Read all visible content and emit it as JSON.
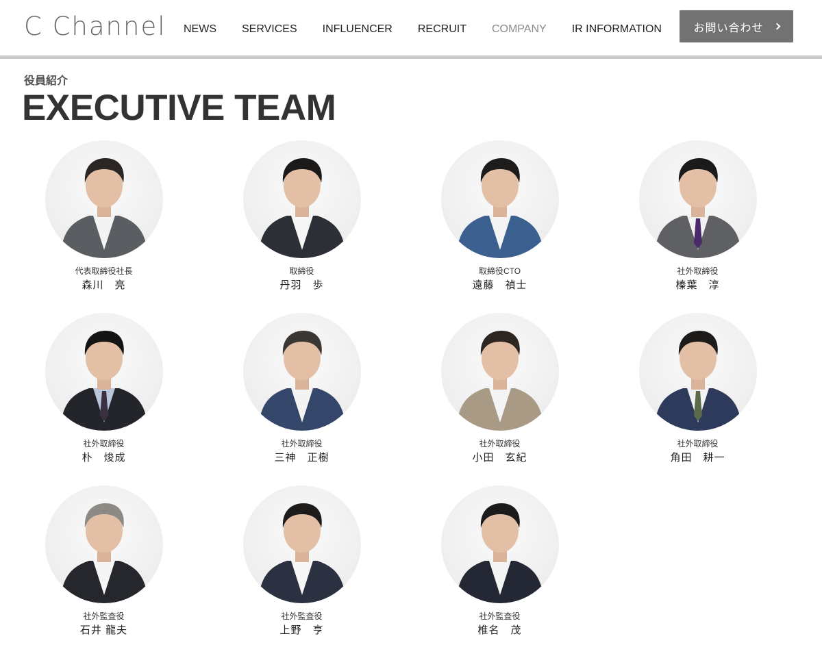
{
  "header": {
    "logo_text": "C Channel",
    "nav": [
      {
        "label": "NEWS",
        "current": false
      },
      {
        "label": "SERVICES",
        "current": false
      },
      {
        "label": "INFLUENCER",
        "current": false
      },
      {
        "label": "RECRUIT",
        "current": false
      },
      {
        "label": "COMPANY",
        "current": true
      },
      {
        "label": "IR INFORMATION",
        "current": false
      }
    ],
    "contact_label": "お問い合わせ",
    "contact_icon": "chevron-right-icon"
  },
  "section": {
    "subtitle": "役員紹介",
    "title": "EXECUTIVE TEAM"
  },
  "members": [
    {
      "role": "代表取締役社長",
      "name": "森川　亮",
      "suit": "#5a5d61",
      "shirt": "#f3f3f3",
      "tie": "",
      "hair": "#2b2623"
    },
    {
      "role": "取締役",
      "name": "丹羽　歩",
      "suit": "#2c2f36",
      "shirt": "#f6f6f6",
      "tie": "",
      "hair": "#1c1a19"
    },
    {
      "role": "取締役CTO",
      "name": "遠藤　禎士",
      "suit": "#3b5f8f",
      "shirt": "#f4f4f4",
      "tie": "",
      "hair": "#1e1c1b"
    },
    {
      "role": "社外取締役",
      "name": "榛葉　淳",
      "suit": "#5e6064",
      "shirt": "#f2f2f2",
      "tie": "#4a2a6a",
      "hair": "#1b1a1a"
    },
    {
      "role": "社外取締役",
      "name": "朴　焌成",
      "suit": "#23252b",
      "shirt": "#b8c6dc",
      "tie": "#3a3040",
      "hair": "#141414"
    },
    {
      "role": "社外取締役",
      "name": "三神　正樹",
      "suit": "#34476b",
      "shirt": "#f3f3f3",
      "tie": "",
      "hair": "#3a3634"
    },
    {
      "role": "社外取締役",
      "name": "小田　玄紀",
      "suit": "#a99a86",
      "shirt": "#f4f4f4",
      "tie": "",
      "hair": "#2c2520"
    },
    {
      "role": "社外取締役",
      "name": "角田　耕一",
      "suit": "#2d3a5c",
      "shirt": "#f2f2f2",
      "tie": "#5a6a4a",
      "hair": "#1d1b1a"
    },
    {
      "role": "社外監査役",
      "name": "石井 龍夫",
      "suit": "#25272c",
      "shirt": "#f5f5f5",
      "tie": "",
      "hair": "#8d8a86"
    },
    {
      "role": "社外監査役",
      "name": "上野　亨",
      "suit": "#2b3140",
      "shirt": "#f6f6f6",
      "tie": "",
      "hair": "#1e1c1b"
    },
    {
      "role": "社外監査役",
      "name": "椎名　茂",
      "suit": "#232834",
      "shirt": "#f4f4f4",
      "tie": "",
      "hair": "#1c1b1b"
    }
  ]
}
